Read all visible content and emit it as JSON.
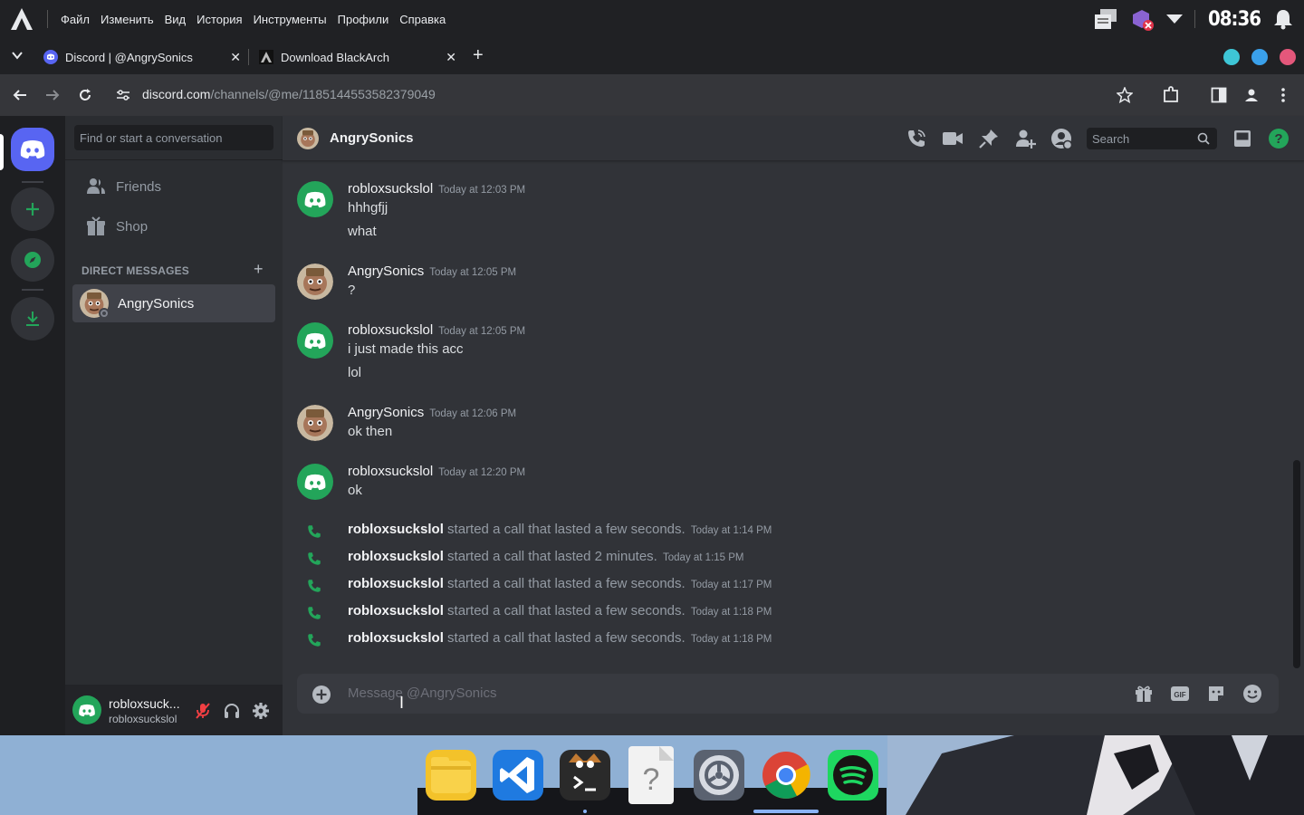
{
  "os": {
    "menu": [
      "Файл",
      "Изменить",
      "Вид",
      "История",
      "Инструменты",
      "Профили",
      "Справка"
    ],
    "clock": "08:36"
  },
  "browser": {
    "tabs": [
      {
        "title": "Discord | @AngrySonics",
        "active": true
      },
      {
        "title": "Download BlackArch",
        "active": false
      }
    ],
    "url_host": "discord.com",
    "url_path": "/channels/@me/1185144553582379049"
  },
  "discord": {
    "search_placeholder": "Find or start a conversation",
    "nav": [
      {
        "label": "Friends"
      },
      {
        "label": "Shop"
      }
    ],
    "direct_messages_header": "DIRECT MESSAGES",
    "dm_list": [
      {
        "name": "AngrySonics"
      }
    ],
    "user": {
      "display": "robloxsuck...",
      "username": "robloxsuckslol"
    },
    "channel": {
      "name": "AngrySonics",
      "search_placeholder": "Search",
      "composer_placeholder": "Message @AngrySonics"
    },
    "messages": [
      {
        "author": "robloxsuckslol",
        "time": "Today at 12:03 PM",
        "lines": [
          "hhhgfjj",
          "what"
        ],
        "avatar": "discord-default"
      },
      {
        "author": "AngrySonics",
        "time": "Today at 12:05 PM",
        "lines": [
          "?"
        ],
        "avatar": "custom"
      },
      {
        "author": "robloxsuckslol",
        "time": "Today at 12:05 PM",
        "lines": [
          "i just made this acc",
          "lol"
        ],
        "avatar": "discord-default"
      },
      {
        "author": "AngrySonics",
        "time": "Today at 12:06 PM",
        "lines": [
          "ok then"
        ],
        "avatar": "custom"
      },
      {
        "author": "robloxsuckslol",
        "time": "Today at 12:20 PM",
        "lines": [
          "ok"
        ],
        "avatar": "discord-default"
      }
    ],
    "calls": [
      {
        "author": "robloxsuckslol",
        "text": "started a call that lasted a few seconds.",
        "time": "Today at 1:14 PM"
      },
      {
        "author": "robloxsuckslol",
        "text": "started a call that lasted 2 minutes.",
        "time": "Today at 1:15 PM"
      },
      {
        "author": "robloxsuckslol",
        "text": "started a call that lasted a few seconds.",
        "time": "Today at 1:17 PM"
      },
      {
        "author": "robloxsuckslol",
        "text": "started a call that lasted a few seconds.",
        "time": "Today at 1:18 PM"
      },
      {
        "author": "robloxsuckslol",
        "text": "started a call that lasted a few seconds.",
        "time": "Today at 1:18 PM"
      }
    ]
  },
  "colors": {
    "blurple": "#5865f2",
    "green": "#23a55a",
    "bg": "#313338"
  }
}
